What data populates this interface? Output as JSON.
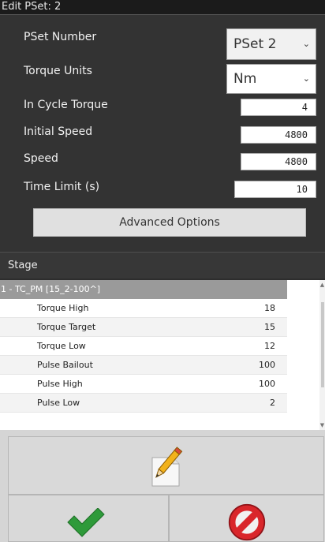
{
  "window": {
    "title": "Edit PSet: 2"
  },
  "form": {
    "pset_number_label": "PSet Number",
    "pset_number_value": "PSet 2",
    "torque_units_label": "Torque Units",
    "torque_units_value": "Nm",
    "in_cycle_torque_label": "In Cycle Torque",
    "in_cycle_torque_value": "4",
    "initial_speed_label": "Initial Speed",
    "initial_speed_value": "4800",
    "speed_label": "Speed",
    "speed_value": "4800",
    "time_limit_label": "Time Limit (s)",
    "time_limit_value": "10",
    "advanced_label": "Advanced Options"
  },
  "stage": {
    "header": "Stage",
    "group_label": "1 - TC_PM [15_2-100^]",
    "rows": [
      {
        "name": "Torque High",
        "value": "18"
      },
      {
        "name": "Torque Target",
        "value": "15"
      },
      {
        "name": "Torque Low",
        "value": "12"
      },
      {
        "name": "Pulse Bailout",
        "value": "100"
      },
      {
        "name": "Pulse High",
        "value": "100"
      },
      {
        "name": "Pulse Low",
        "value": "2"
      }
    ]
  },
  "icons": {
    "edit": "pencil-paper-icon",
    "confirm": "green-check-icon",
    "cancel": "red-prohibit-icon"
  },
  "colors": {
    "confirm": "#2e9a3a",
    "cancel": "#d9262b"
  }
}
